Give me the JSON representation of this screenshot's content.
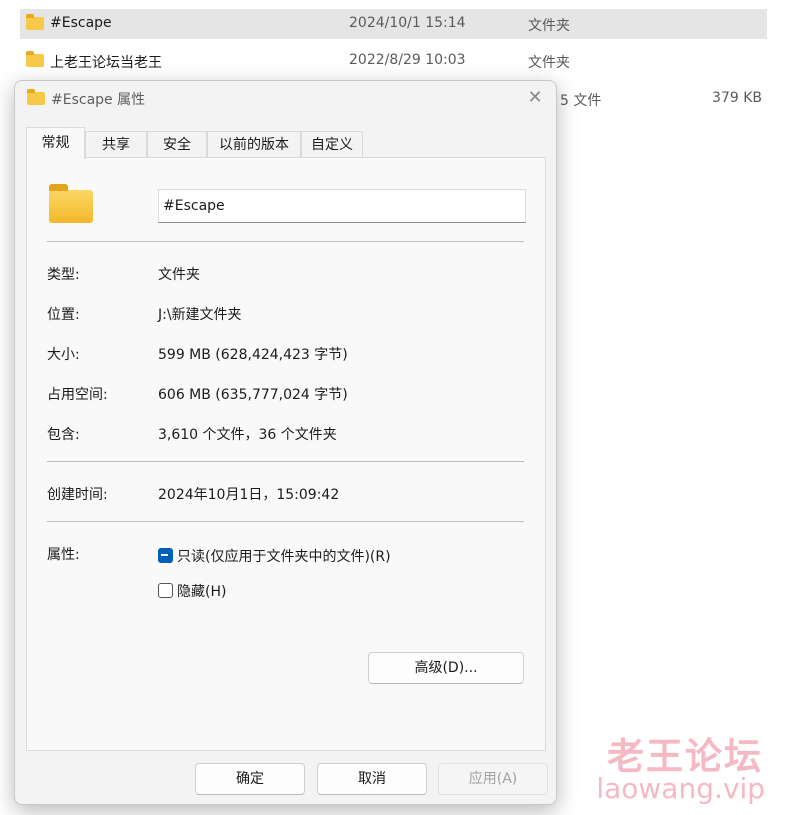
{
  "explorer": {
    "rows": [
      {
        "name": "#Escape",
        "date": "2024/10/1 15:14",
        "type": "文件夹"
      },
      {
        "name": "上老王论坛当老王",
        "date": "2022/8/29 10:03",
        "type": "文件夹"
      }
    ],
    "row3_type_fragment": "5 文件",
    "row3_size": "379 KB"
  },
  "watermark": {
    "cn": "老王论坛",
    "en": "laowang.vip"
  },
  "dialog": {
    "title": "#Escape 属性",
    "close_glyph": "✕",
    "tabs": [
      "常规",
      "共享",
      "安全",
      "以前的版本",
      "自定义"
    ],
    "active_tab": "常规",
    "name_value": "#Escape",
    "props": {
      "type_label": "类型:",
      "type_value": "文件夹",
      "location_label": "位置:",
      "location_value": "J:\\新建文件夹",
      "size_label": "大小:",
      "size_value": "599 MB (628,424,423 字节)",
      "disk_label": "占用空间:",
      "disk_value": "606 MB (635,777,024 字节)",
      "contains_label": "包含:",
      "contains_value": "3,610 个文件，36 个文件夹",
      "created_label": "创建时间:",
      "created_value": "2024年10月1日，15:09:42",
      "attr_label": "属性:"
    },
    "attributes": {
      "readonly_label": "只读(仅应用于文件夹中的文件)(R)",
      "readonly_state": "indeterminate",
      "hidden_label": "隐藏(H)",
      "hidden_state": "unchecked",
      "advanced_button": "高级(D)..."
    },
    "buttons": {
      "ok": "确定",
      "cancel": "取消",
      "apply": "应用(A)"
    }
  },
  "colors": {
    "accent": "#005fb8",
    "folder": "#f7c948",
    "watermark": "#f5b9c3"
  }
}
